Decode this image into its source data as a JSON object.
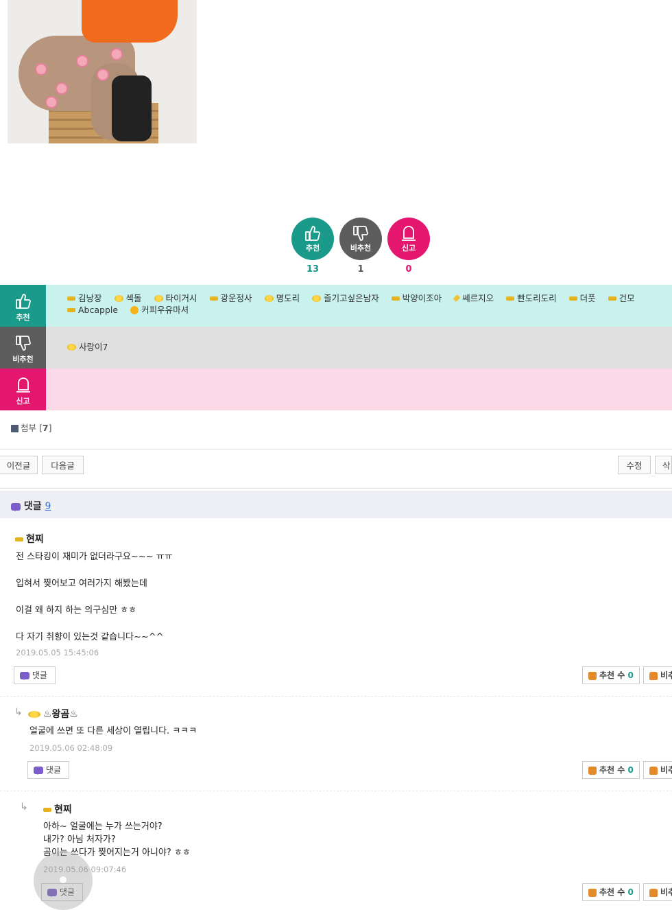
{
  "votes": {
    "up": {
      "label": "추천",
      "count": "13",
      "color": "#1a9a8a"
    },
    "down": {
      "label": "비추천",
      "count": "1",
      "color": "#5d5d5d"
    },
    "report": {
      "label": "신고",
      "count": "0",
      "color": "#e4166e"
    }
  },
  "voters": {
    "up_label": "추천",
    "up_names": [
      "김낭장",
      "섹돌",
      "타이거시",
      "광운정사",
      "명도리",
      "즐기고싶은남자",
      "박양이조아",
      "쎄르지오",
      "빤도리도리",
      "더풋",
      "건모",
      "Abcapple",
      "커피우유마셔"
    ],
    "down_label": "비추천",
    "down_names": [
      "사랑이7"
    ],
    "report_label": "신고"
  },
  "attachment": {
    "label": "첨부 [",
    "count": "7",
    "close": "]"
  },
  "nav": {
    "prev": "이전글",
    "next": "다음글",
    "edit": "수정",
    "delete": "삭제"
  },
  "comments_header": {
    "label": "댓글",
    "count": "9"
  },
  "comments": [
    {
      "author": "현찌",
      "lines": [
        "전 스타킹이 재미가 없더라구요~~~ ㅠㅠ",
        "입혀서 찢어보고 여러가지 해봤는데",
        "이걸 왜 하지 하는 의구심만 ㅎㅎ",
        "다 자기 취향이 있는것 같습니다~~^^"
      ],
      "date": "2019.05.05 15:45:06",
      "reply_label": "댓글",
      "like_label": "추천 수",
      "likes": "0",
      "dislike_label": "비추"
    },
    {
      "author": "♨왕곰♨",
      "lines": [
        "얼굴에 쓰면 또 다른 세상이 열립니다. ㅋㅋㅋ"
      ],
      "date": "2019.05.06 02:48:09",
      "reply_label": "댓글",
      "like_label": "추천 수",
      "likes": "0",
      "dislike_label": "비추"
    },
    {
      "author": "현찌",
      "lines": [
        "아하~ 얼굴에는 누가 쓰는거야?",
        "내가? 아님 처자가?",
        "곰이는 쓰다가 찢어지는거 아니야? ㅎㅎ"
      ],
      "date": "2019.05.06 09:07:46",
      "reply_label": "댓글",
      "like_label": "추천 수",
      "likes": "0",
      "dislike_label": "비추"
    }
  ]
}
